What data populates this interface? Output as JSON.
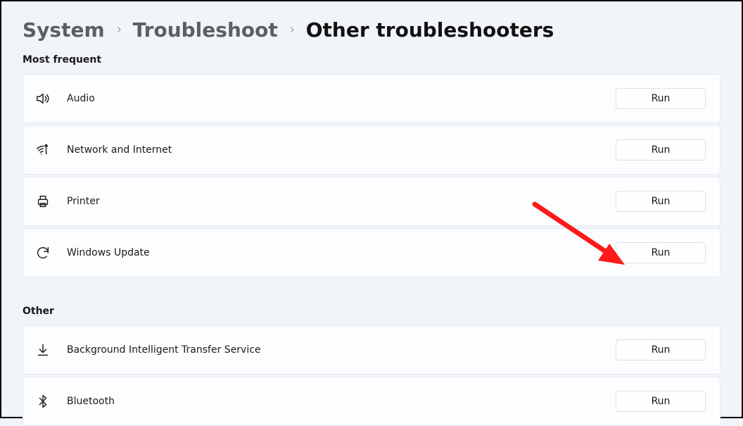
{
  "breadcrumbs": {
    "root": "System",
    "mid": "Troubleshoot",
    "current": "Other troubleshooters"
  },
  "sections": {
    "most_frequent": {
      "label": "Most frequent",
      "items": [
        {
          "label": "Audio",
          "icon": "audio-icon",
          "run": "Run"
        },
        {
          "label": "Network and Internet",
          "icon": "network-icon",
          "run": "Run"
        },
        {
          "label": "Printer",
          "icon": "printer-icon",
          "run": "Run"
        },
        {
          "label": "Windows Update",
          "icon": "update-icon",
          "run": "Run"
        }
      ]
    },
    "other": {
      "label": "Other",
      "items": [
        {
          "label": "Background Intelligent Transfer Service",
          "icon": "download-icon",
          "run": "Run"
        },
        {
          "label": "Bluetooth",
          "icon": "bluetooth-icon",
          "run": "Run"
        }
      ]
    }
  },
  "annotation": {
    "arrow_color": "#ff1a1a"
  }
}
